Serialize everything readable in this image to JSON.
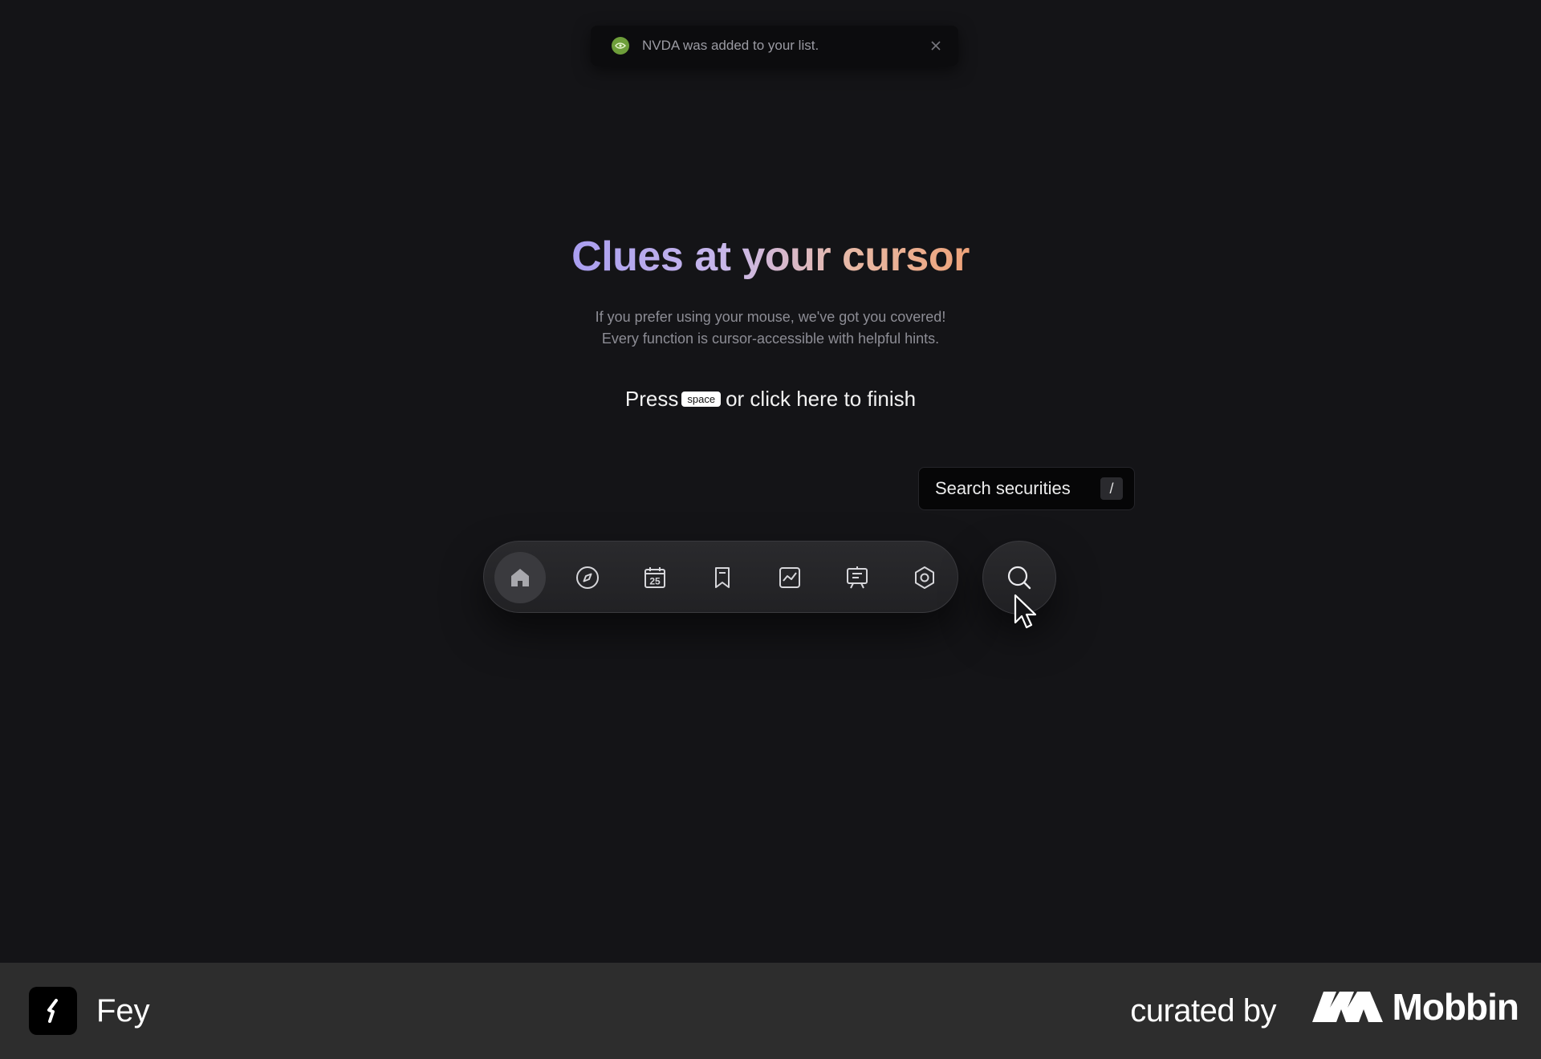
{
  "toast": {
    "icon": "nvidia-logo-icon",
    "message": "NVDA was added to your list.",
    "close_icon": "close-icon"
  },
  "headline": {
    "text": "Clues at your cursor"
  },
  "subtitle": {
    "line1": "If you prefer using your mouse, we've got you covered!",
    "line2": "Every function is cursor-accessible with helpful hints."
  },
  "finish": {
    "prefix": "Press",
    "key": "space",
    "suffix": "or click here to finish"
  },
  "tooltip": {
    "label": "Search securities",
    "shortcut": "/"
  },
  "dock": {
    "items": [
      {
        "name": "home",
        "icon": "home-icon",
        "active": true
      },
      {
        "name": "explore",
        "icon": "compass-icon",
        "active": false
      },
      {
        "name": "calendar",
        "icon": "calendar-icon",
        "label": "25",
        "active": false
      },
      {
        "name": "watchlist",
        "icon": "bookmark-icon",
        "active": false
      },
      {
        "name": "charts",
        "icon": "chart-icon",
        "active": false
      },
      {
        "name": "presentations",
        "icon": "presentation-icon",
        "active": false
      },
      {
        "name": "settings",
        "icon": "settings-icon",
        "active": false
      }
    ],
    "search_icon": "search-icon"
  },
  "footer": {
    "app_name": "Fey",
    "curated_by": "curated by",
    "brand": "Mobbin"
  }
}
